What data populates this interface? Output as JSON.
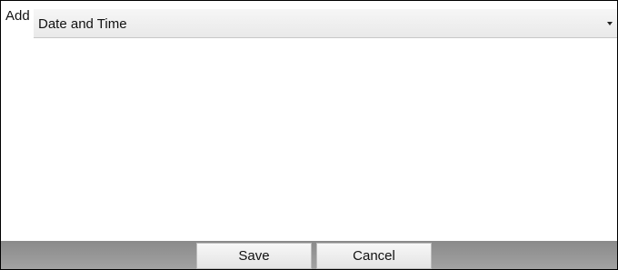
{
  "dialog": {
    "add_label": "Add",
    "select": {
      "value": "Date and Time",
      "icon": "chevron-down-icon"
    },
    "buttons": {
      "save_label": "Save",
      "cancel_label": "Cancel"
    }
  },
  "colors": {
    "background": "#ffffff",
    "border": "#000000",
    "footer": "#9a9a9a",
    "button": "#ededed",
    "text": "#111111"
  }
}
